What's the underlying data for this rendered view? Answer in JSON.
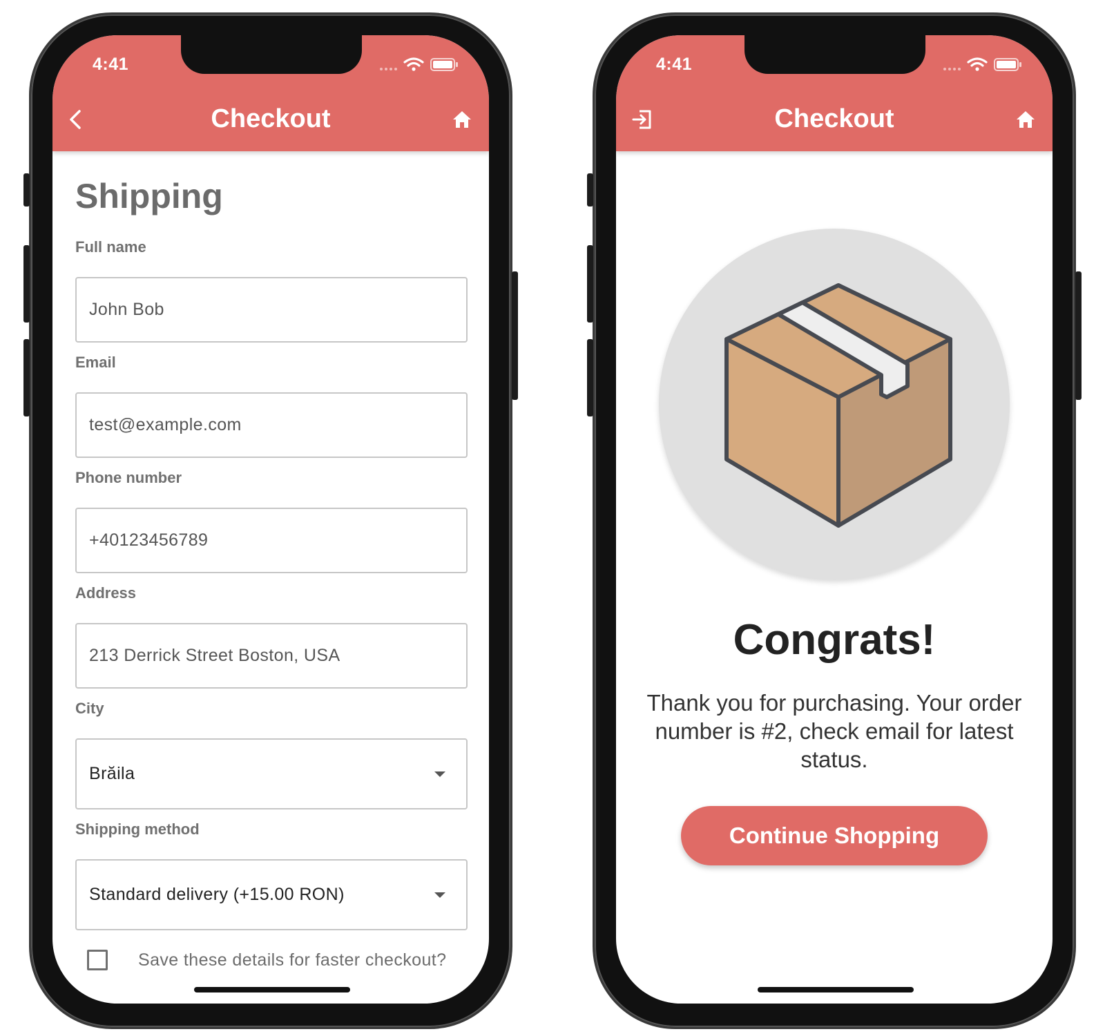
{
  "left_screen": {
    "status": {
      "time": "4:41"
    },
    "header": {
      "title": "Checkout",
      "left_icon": "chevron-left-icon",
      "right_icon": "home-icon"
    },
    "section_title": "Shipping",
    "fields": {
      "full_name": {
        "label": "Full name",
        "value": "John Bob"
      },
      "email": {
        "label": "Email",
        "value": "test@example.com"
      },
      "phone": {
        "label": "Phone number",
        "value": "+40123456789"
      },
      "address": {
        "label": "Address",
        "value": "213 Derrick Street Boston, USA"
      },
      "city": {
        "label": "City",
        "value": "Brăila"
      },
      "shipping_method": {
        "label": "Shipping method",
        "value": "Standard delivery (+15.00 RON)"
      }
    },
    "save_details": {
      "label": "Save these details for faster checkout?",
      "checked": false
    }
  },
  "right_screen": {
    "status": {
      "time": "4:41"
    },
    "header": {
      "title": "Checkout",
      "left_icon": "logout-icon",
      "right_icon": "home-icon"
    },
    "illustration": "package-box-icon",
    "heading": "Congrats!",
    "message": "Thank you for purchasing. Your order number is #2, check email for latest status.",
    "button_label": "Continue Shopping"
  },
  "colors": {
    "accent": "#e06b66",
    "box_light": "#d6aa7f",
    "box_dark": "#bf9a78",
    "circle_bg": "#e0e0e0"
  }
}
